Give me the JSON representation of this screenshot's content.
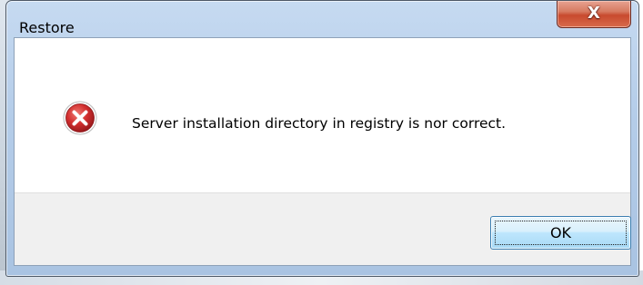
{
  "dialog": {
    "title": "Restore",
    "message": "Server installation directory in registry is nor correct.",
    "icon": "error-icon",
    "ok_label": "OK",
    "close_label": "X"
  },
  "colors": {
    "titlebar": "#b5cde9",
    "close_button": "#c84a2e",
    "error_icon_red": "#c4262e",
    "footer": "#f0f0f0",
    "ok_button_border": "#3c7fb1"
  }
}
